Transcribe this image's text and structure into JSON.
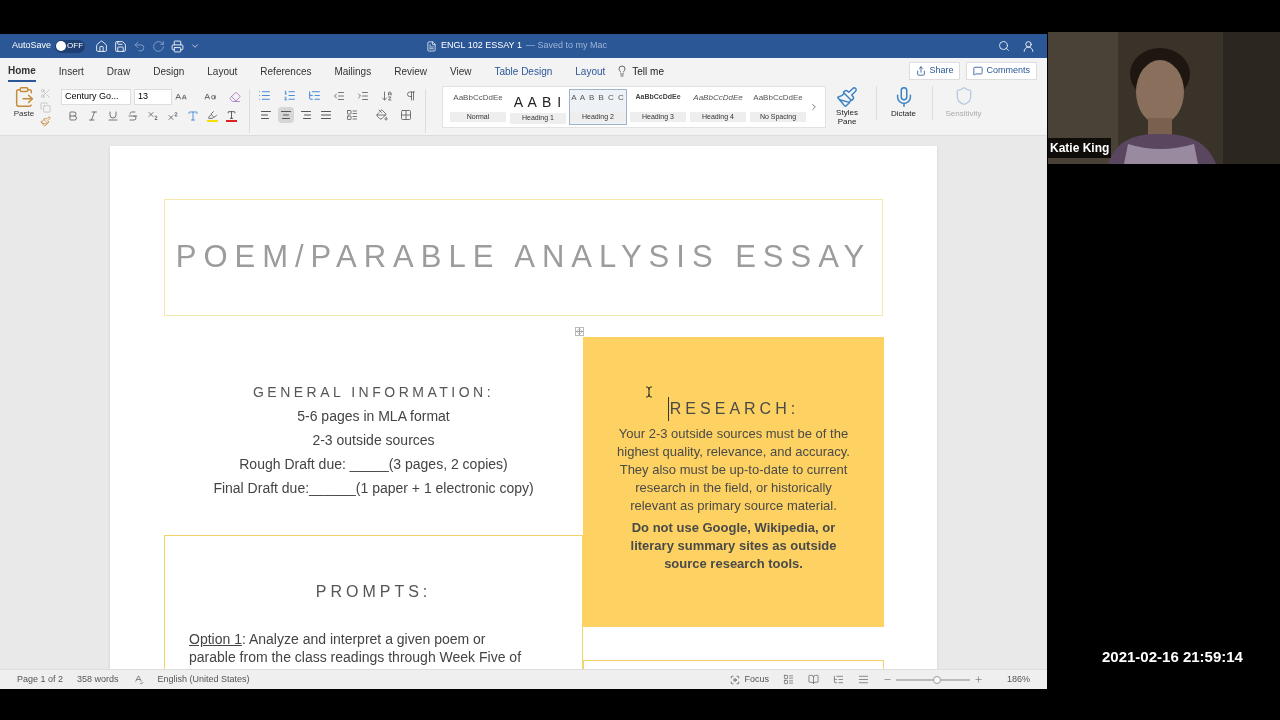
{
  "title_bar": {
    "autosave_label": "AutoSave",
    "autosave": {
      "on": false,
      "label": "OFF"
    },
    "document_title": "ENGL 102 ESSAY 1",
    "save_status": "— Saved to my Mac"
  },
  "tabs": [
    {
      "label": "Home",
      "selected": true,
      "kind": "standard"
    },
    {
      "label": "Insert",
      "selected": false,
      "kind": "standard"
    },
    {
      "label": "Draw",
      "selected": false,
      "kind": "standard"
    },
    {
      "label": "Design",
      "selected": false,
      "kind": "standard"
    },
    {
      "label": "Layout",
      "selected": false,
      "kind": "standard"
    },
    {
      "label": "References",
      "selected": false,
      "kind": "standard"
    },
    {
      "label": "Mailings",
      "selected": false,
      "kind": "standard"
    },
    {
      "label": "Review",
      "selected": false,
      "kind": "standard"
    },
    {
      "label": "View",
      "selected": false,
      "kind": "standard"
    },
    {
      "label": "Table Design",
      "selected": false,
      "kind": "contextual"
    },
    {
      "label": "Layout",
      "selected": false,
      "kind": "contextual"
    }
  ],
  "tell_me": "Tell me",
  "share": "Share",
  "comments": "Comments",
  "ribbon": {
    "paste": "Paste",
    "font_name": "Century Go...",
    "font_size": "13",
    "alignment": [
      {
        "kind": "left",
        "selected": false
      },
      {
        "kind": "center",
        "selected": true
      },
      {
        "kind": "right",
        "selected": false
      },
      {
        "kind": "justify",
        "selected": false
      }
    ],
    "styles": [
      {
        "sample": "AaBbCcDdEe",
        "label": "Normal",
        "selected": false,
        "kind": "normal"
      },
      {
        "sample": "A A B I",
        "label": "Heading 1",
        "selected": false,
        "kind": "h1"
      },
      {
        "sample": "A A B B C C",
        "label": "Heading 2",
        "selected": true,
        "kind": "h2"
      },
      {
        "sample": "AaBbCcDdEe",
        "label": "Heading 3",
        "selected": false,
        "kind": "h3"
      },
      {
        "sample": "AaBbCcDdEe",
        "label": "Heading 4",
        "selected": false,
        "kind": "h4"
      },
      {
        "sample": "AaBbCcDdEe",
        "label": "No Spacing",
        "selected": false,
        "kind": "normal"
      }
    ],
    "styles_pane": "Styles Pane",
    "dictate": "Dictate",
    "sensitivity": {
      "label": "Sensitivity",
      "disabled": true
    }
  },
  "document": {
    "title": "POEM/PARABLE ANALYSIS ESSAY",
    "general_heading": "GENERAL INFORMATION:",
    "general_lines": [
      "5-6 pages in MLA format",
      "2-3 outside sources",
      "Rough Draft due: _____(3 pages, 2 copies)",
      "Final Draft due:______(1 paper + 1 electronic copy)"
    ],
    "research_heading": "RESEARCH:",
    "research_text": "Your 2-3 outside sources must be of the highest quality, relevance, and accuracy. They also must be up-to-date to current research in the field, or historically relevant as primary source material.",
    "research_note": "Do not use Google, Wikipedia, or literary summary sites as outside source research tools.",
    "prompts_heading": "PROMPTS:",
    "option_label": "Option 1",
    "option_text": ": Analyze and interpret a given poem or parable from the class readings through Week Five of"
  },
  "status_bar": {
    "page": "Page 1 of 2",
    "words": "358 words",
    "language": "English (United States)",
    "focus": "Focus",
    "zoom": {
      "level": 0.56,
      "reading": "186%"
    }
  },
  "video": {
    "name": "Katie King",
    "kind": "picture"
  },
  "timestamp": "2021-02-16 21:59:14"
}
